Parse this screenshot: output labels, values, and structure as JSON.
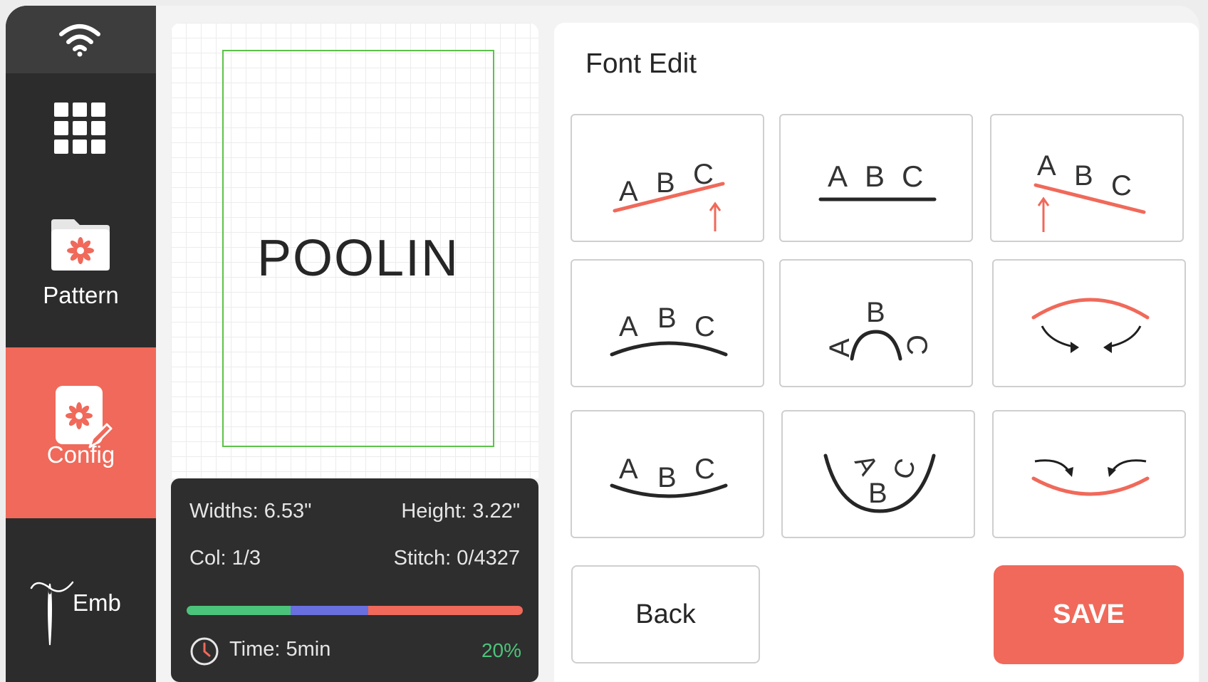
{
  "sidebar": {
    "items": [
      {
        "label": "Pattern"
      },
      {
        "label": "Config"
      },
      {
        "label": "Emb"
      }
    ]
  },
  "canvas": {
    "design_text": "POOLIN"
  },
  "info": {
    "width": "Widths: 6.53\"",
    "height": "Height: 3.22\"",
    "col": "Col: 1/3",
    "stitch": "Stitch: 0/4327",
    "time": "Time: 5min",
    "percent": "20%",
    "progress_segments": [
      {
        "color": "#4cc37a",
        "fraction": 0.31
      },
      {
        "color": "#6a6fe0",
        "fraction": 0.23
      },
      {
        "color": "#f0695a",
        "fraction": 0.46
      }
    ]
  },
  "font_edit": {
    "title": "Font Edit",
    "tile_letters": [
      "A",
      "B",
      "C"
    ],
    "tiles": [
      {
        "name": "slant-up"
      },
      {
        "name": "straight"
      },
      {
        "name": "slant-down"
      },
      {
        "name": "arc-over"
      },
      {
        "name": "circle-top"
      },
      {
        "name": "increase-arc"
      },
      {
        "name": "arc-under"
      },
      {
        "name": "circle-bottom"
      },
      {
        "name": "decrease-arc"
      }
    ],
    "back_label": "Back",
    "save_label": "SAVE"
  },
  "colors": {
    "accent": "#f0695a",
    "sidebar": "#2c2c2c",
    "hoop": "#5cc34a"
  }
}
